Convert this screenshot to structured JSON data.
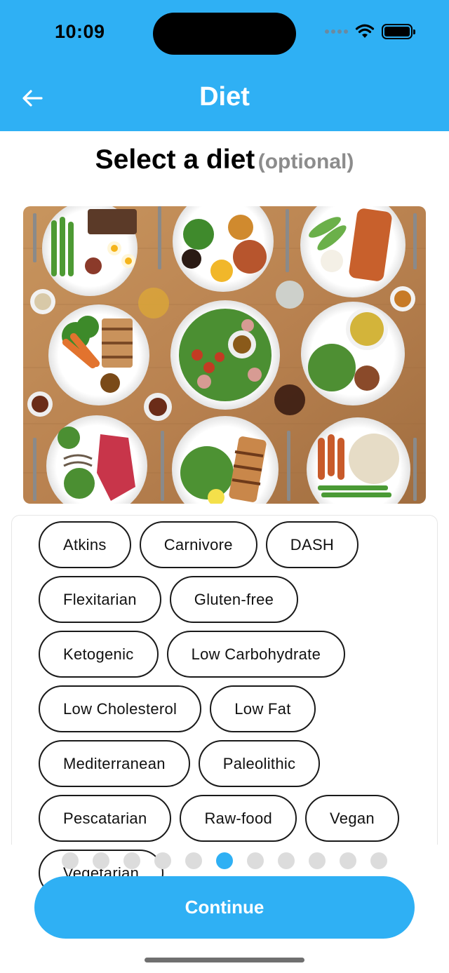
{
  "status_bar": {
    "time": "10:09"
  },
  "nav": {
    "title": "Diet",
    "back_icon": "arrow-left-icon"
  },
  "headline": {
    "main": "Select a diet",
    "sub": "(optional)"
  },
  "diets": [
    "Atkins",
    "Carnivore",
    "DASH",
    "Flexitarian",
    "Gluten-free",
    "Ketogenic",
    "Low Carbohydrate",
    "Low Cholesterol",
    "Low Fat",
    "Mediterranean",
    "Paleolithic",
    "Pescatarian",
    "Raw-food",
    "Vegan",
    "Vegetarian"
  ],
  "pager": {
    "total": 11,
    "current": 6
  },
  "cta": {
    "label": "Continue"
  },
  "colors": {
    "accent": "#2fb0f4",
    "muted": "#8c8c8c",
    "dot_inactive": "#dcdcdc"
  }
}
